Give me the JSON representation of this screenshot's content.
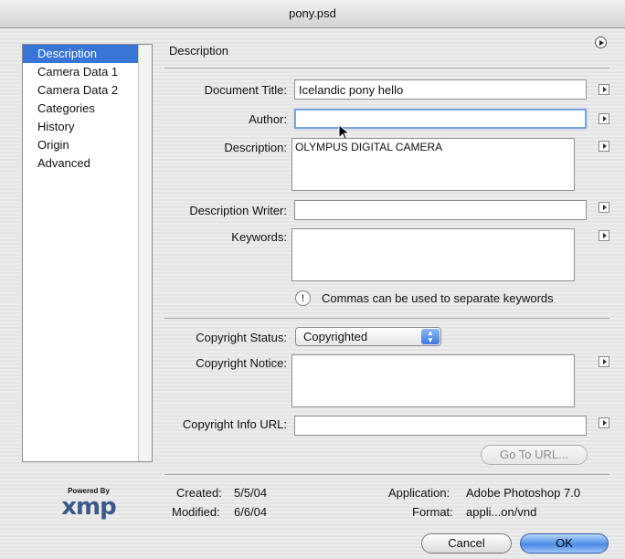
{
  "window": {
    "title": "pony.psd"
  },
  "sidebar": {
    "items": [
      {
        "label": "Description"
      },
      {
        "label": "Camera Data 1"
      },
      {
        "label": "Camera Data 2"
      },
      {
        "label": "Categories"
      },
      {
        "label": "History"
      },
      {
        "label": "Origin"
      },
      {
        "label": "Advanced"
      }
    ],
    "selected": "Description"
  },
  "pane": {
    "title": "Description"
  },
  "form": {
    "document_title": {
      "label": "Document Title:",
      "value": "Icelandic pony hello"
    },
    "author": {
      "label": "Author:",
      "value": ""
    },
    "description": {
      "label": "Description:",
      "value": "OLYMPUS DIGITAL CAMERA"
    },
    "description_writer": {
      "label": "Description Writer:",
      "value": ""
    },
    "keywords": {
      "label": "Keywords:",
      "value": ""
    },
    "keywords_hint": "Commas can be used to separate keywords",
    "copyright_status": {
      "label": "Copyright Status:",
      "value": "Copyrighted"
    },
    "copyright_notice": {
      "label": "Copyright Notice:",
      "value": ""
    },
    "copyright_url": {
      "label": "Copyright Info URL:",
      "value": ""
    },
    "go_to_url": "Go To URL..."
  },
  "footer": {
    "logo_powered_by": "Powered By",
    "logo_text": "xmp",
    "created_label": "Created:",
    "created": "5/5/04",
    "modified_label": "Modified:",
    "modified": "6/6/04",
    "application_label": "Application:",
    "application": "Adobe Photoshop 7.0",
    "format_label": "Format:",
    "format": "appli...on/vnd"
  },
  "buttons": {
    "cancel": "Cancel",
    "ok": "OK"
  },
  "colors": {
    "selection": "#3875d7",
    "focus_ring": "#7aa4e0",
    "default_button": "#4c8ae6"
  }
}
